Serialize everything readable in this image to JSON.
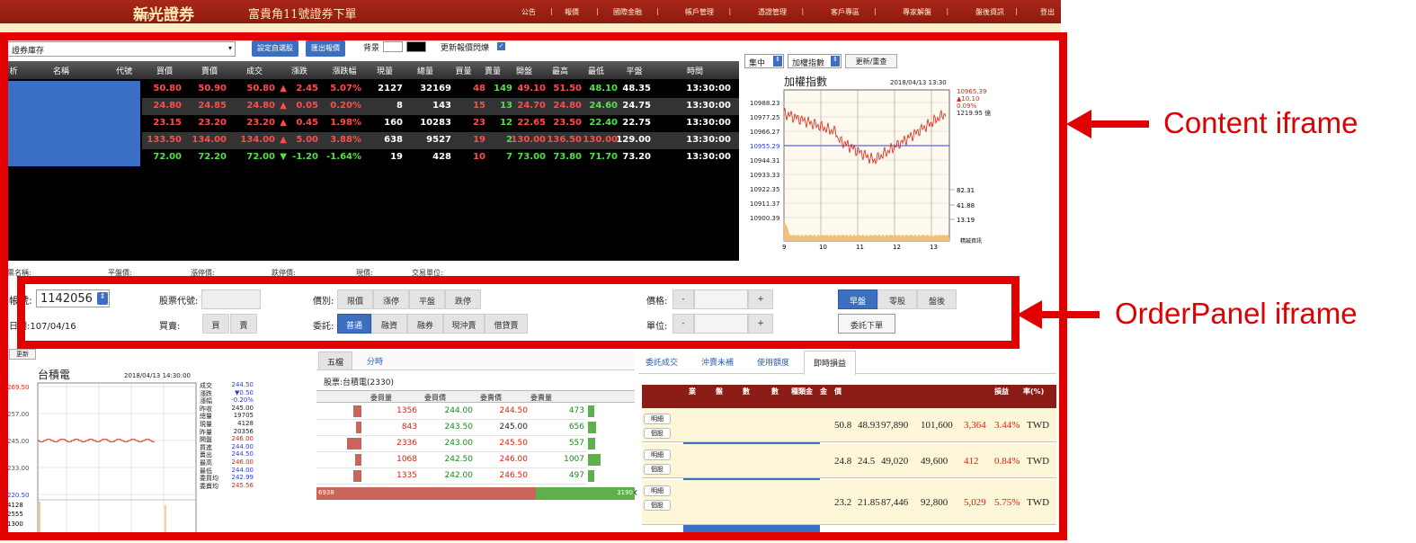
{
  "header": {
    "logo": "新光證券",
    "logo_sub": "SKIS",
    "slogan": "富貴角11號證券下單",
    "nav": [
      "公告",
      "報價",
      "國際金融",
      "帳戶管理",
      "憑證管理",
      "客戶專區",
      "專家解盤",
      "盤後資訊",
      "登出"
    ]
  },
  "toolbar": {
    "portfolio_select": "證券庫存",
    "set_watchlist": "設定自選股",
    "export_quotes": "匯出報價",
    "background_label": "背景",
    "flash_label": "更新報價閃爍"
  },
  "quote_table": {
    "headers": [
      "析",
      "名稱",
      "代號",
      "買價",
      "賣價",
      "成交",
      "漲跌",
      "漲跌幅",
      "現量",
      "總量",
      "買量",
      "賣量",
      "開盤",
      "最高",
      "最低",
      "平盤",
      "時間"
    ],
    "rows": [
      {
        "bid": "50.80",
        "ask": "50.90",
        "last": "50.80",
        "dir": "▲",
        "chg": "2.45",
        "pct": "5.07%",
        "vol": "2127",
        "total": "32169",
        "bq": "48",
        "aq": "149",
        "open": "49.10",
        "high": "51.50",
        "low": "48.10",
        "ref": "48.35",
        "time": "13:30:00",
        "color": "up"
      },
      {
        "bid": "24.80",
        "ask": "24.85",
        "last": "24.80",
        "dir": "▲",
        "chg": "0.05",
        "pct": "0.20%",
        "vol": "8",
        "total": "143",
        "bq": "15",
        "aq": "13",
        "open": "24.70",
        "high": "24.80",
        "low": "24.60",
        "ref": "24.75",
        "time": "13:30:00",
        "color": "up"
      },
      {
        "bid": "23.15",
        "ask": "23.20",
        "last": "23.20",
        "dir": "▲",
        "chg": "0.45",
        "pct": "1.98%",
        "vol": "160",
        "total": "10283",
        "bq": "23",
        "aq": "12",
        "open": "22.65",
        "high": "23.50",
        "low": "22.40",
        "ref": "22.75",
        "time": "13:30:00",
        "color": "up"
      },
      {
        "bid": "133.50",
        "ask": "134.00",
        "last": "134.00",
        "dir": "▲",
        "chg": "5.00",
        "pct": "3.88%",
        "vol": "638",
        "total": "9527",
        "bq": "19",
        "aq": "2",
        "open": "130.00",
        "high": "136.50",
        "low": "130.00",
        "ref": "129.00",
        "time": "13:30:00",
        "color": "up"
      },
      {
        "bid": "72.00",
        "ask": "72.20",
        "last": "72.00",
        "dir": "▼",
        "chg": "-1.20",
        "pct": "-1.64%",
        "vol": "19",
        "total": "428",
        "bq": "10",
        "aq": "7",
        "open": "73.00",
        "high": "73.80",
        "low": "71.70",
        "ref": "73.20",
        "time": "13:30:00",
        "color": "down"
      }
    ]
  },
  "info_line": [
    "股票名稱:",
    "平盤價:",
    "漲停價:",
    "跌停價:",
    "現價:",
    "交易單位:"
  ],
  "index_chart": {
    "market_select": "集中",
    "index_select": "加權指數",
    "refresh": "更新/重查",
    "title": "加權指數",
    "datetime": "2018/04/13 13:30",
    "y_ticks": [
      "10988.23",
      "10977.25",
      "10966.27",
      "10955.29",
      "10944.31",
      "10933.33",
      "10922.35",
      "10911.37",
      "10900.39"
    ],
    "x_ticks": [
      "9",
      "10",
      "11",
      "12",
      "13"
    ],
    "last": "10965.39",
    "change": "▲10.10",
    "pct": "0.09%",
    "amount": "1219.95 億",
    "vol_ticks": [
      "82.31",
      "41.88",
      "13.19"
    ],
    "source": "精誠資訊"
  },
  "order_panel": {
    "account_label": "帳號:",
    "account": "1142056",
    "date_label": "日期:",
    "date": "107/04/16",
    "stock_code_label": "股票代號:",
    "side_label": "買賣:",
    "buy": "買",
    "sell": "賣",
    "price_type_label": "價別:",
    "price_types": [
      "限價",
      "漲停",
      "平盤",
      "跌停"
    ],
    "order_type_label": "委託:",
    "order_types": [
      "普通",
      "融資",
      "融券",
      "現沖賣",
      "借貸賣"
    ],
    "price_label": "價格:",
    "unit_label": "單位:",
    "minus": "-",
    "plus": "+",
    "sessions": [
      "早盤",
      "零股",
      "盤後"
    ],
    "submit": "委託下單"
  },
  "stock_chart": {
    "refresh": "更新",
    "title": "台積電",
    "datetime": "2018/04/13 14:30:00",
    "y_ticks": [
      "269.50",
      "257.00",
      "245.00",
      "233.00",
      "220.50"
    ],
    "vol_ticks": [
      "4128",
      "2555",
      "1300"
    ],
    "stats_labels": [
      "成交",
      "漲跌",
      "漲幅",
      "昨收",
      "總量",
      "現量",
      "昨量",
      "開盤",
      "買進",
      "賣出",
      "最高",
      "最低",
      "委買均",
      "委賣均"
    ],
    "stats_values": [
      "244.50",
      "▼0.50",
      "-0.20%",
      "245.00",
      "19705",
      "4128",
      "20356",
      "246.00",
      "244.00",
      "244.50",
      "246.00",
      "244.00",
      "242.99",
      "245.56"
    ]
  },
  "order_book": {
    "tabs": [
      "五檔",
      "分時"
    ],
    "stock": "股票:台積電(2330)",
    "headers": [
      "委買量",
      "委買價",
      "委賣價",
      "委賣量"
    ],
    "rows": [
      {
        "bq": "1356",
        "bp": "244.00",
        "ap": "244.50",
        "aq": "473"
      },
      {
        "bq": "843",
        "bp": "243.50",
        "ap": "245.00",
        "aq": "656"
      },
      {
        "bq": "2336",
        "bp": "243.00",
        "ap": "245.50",
        "aq": "557"
      },
      {
        "bq": "1068",
        "bp": "242.50",
        "ap": "246.00",
        "aq": "1007"
      },
      {
        "bq": "1335",
        "bp": "242.00",
        "ap": "246.50",
        "aq": "497"
      }
    ],
    "bid_total": "6938",
    "ask_total": "3190",
    "bid_share": 0.69
  },
  "positions": {
    "tabs": [
      "委託成交",
      "沖賣未補",
      "使用額度",
      "即時損益"
    ],
    "headers": [
      "業",
      "盤",
      "數",
      "數",
      "種類",
      "金",
      "金",
      "價",
      "",
      "",
      "",
      "",
      "損益",
      "率(%)",
      ""
    ],
    "detail_label": "明細",
    "sell_label": "個股",
    "rows": [
      {
        "a": "50.8",
        "b": "48.93",
        "c": "97,890",
        "d": "101,600",
        "pl": "3,364",
        "rate": "3.44%",
        "ccy": "TWD"
      },
      {
        "a": "24.8",
        "b": "24.5",
        "c": "49,020",
        "d": "49,600",
        "pl": "412",
        "rate": "0.84%",
        "ccy": "TWD"
      },
      {
        "a": "23.2",
        "b": "21.85",
        "c": "87,446",
        "d": "92,800",
        "pl": "5,029",
        "rate": "5.75%",
        "ccy": "TWD"
      }
    ]
  },
  "annotations": {
    "content": "Content iframe",
    "order": "OrderPanel iframe"
  }
}
